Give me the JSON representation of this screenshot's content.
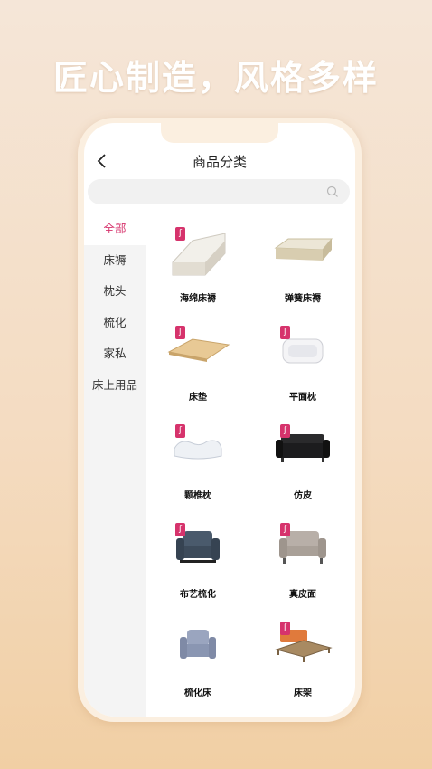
{
  "headline": "匠心制造，风格多样",
  "navbar": {
    "title": "商品分类"
  },
  "search": {
    "placeholder": "",
    "value": ""
  },
  "sidebar": {
    "items": [
      {
        "label": "全部"
      },
      {
        "label": "床褥"
      },
      {
        "label": "枕头"
      },
      {
        "label": "梳化"
      },
      {
        "label": "家私"
      },
      {
        "label": "床上用品"
      }
    ],
    "active_index": 0
  },
  "products": [
    {
      "label": "海绵床褥",
      "icon": "foam-mattress-image",
      "badge": true
    },
    {
      "label": "弹簧床褥",
      "icon": "spring-mattress-image",
      "badge": false
    },
    {
      "label": "床垫",
      "icon": "bed-pad-image",
      "badge": true
    },
    {
      "label": "平面枕",
      "icon": "flat-pillow-image",
      "badge": true
    },
    {
      "label": "颗椎枕",
      "icon": "cervical-pillow-image",
      "badge": true
    },
    {
      "label": "仿皮",
      "icon": "leather-sofa-image",
      "badge": true
    },
    {
      "label": "布艺梳化",
      "icon": "fabric-sofa-image",
      "badge": true
    },
    {
      "label": "真皮面",
      "icon": "genuine-leather-sofa-image",
      "badge": true
    },
    {
      "label": "梳化床",
      "icon": "sofa-bed-image",
      "badge": false
    },
    {
      "label": "床架",
      "icon": "bed-frame-image",
      "badge": true
    }
  ],
  "colors": {
    "accent": "#d6336c",
    "background": "#f4dcc2"
  }
}
